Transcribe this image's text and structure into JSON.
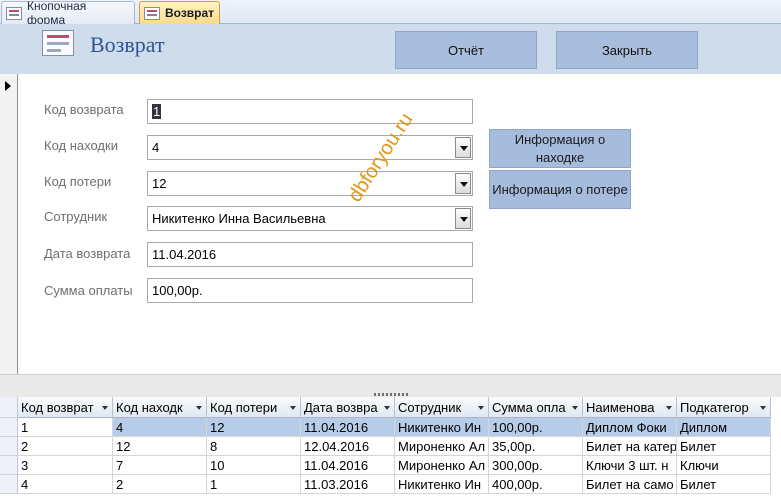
{
  "tabs": [
    {
      "label": "Кнопочная форма",
      "active": false
    },
    {
      "label": "Возврат",
      "active": true
    }
  ],
  "header": {
    "title": "Возврат",
    "report_label": "Отчёт",
    "close_label": "Закрыть"
  },
  "form": {
    "fields": [
      {
        "name": "return-id",
        "label": "Код возврата",
        "value": "1",
        "type": "text"
      },
      {
        "name": "found-id",
        "label": "Код находки",
        "value": "4",
        "type": "combo"
      },
      {
        "name": "loss-id",
        "label": "Код потери",
        "value": "12",
        "type": "combo"
      },
      {
        "name": "employee",
        "label": "Сотрудник",
        "value": "Никитенко Инна Васильевна",
        "type": "combo"
      },
      {
        "name": "return-date",
        "label": "Дата возврата",
        "value": "11.04.2016",
        "type": "text"
      },
      {
        "name": "payment-sum",
        "label": "Сумма оплаты",
        "value": "100,00р.",
        "type": "text"
      }
    ],
    "found_info_label": "Информация о находке",
    "loss_info_label": "Информация о потере",
    "watermark": "dbforyou.ru"
  },
  "datasheet": {
    "columns": [
      "Код возврат",
      "Код находк",
      "Код потери",
      "Дата возвра",
      "Сотрудник",
      "Сумма опла",
      "Наименова",
      "Подкатегор"
    ],
    "rows": [
      [
        "1",
        "4",
        "12",
        "11.04.2016",
        "Никитенко Ин",
        "100,00р.",
        "Диплом Фоки",
        "Диплом"
      ],
      [
        "2",
        "12",
        "8",
        "12.04.2016",
        "Мироненко Ал",
        "35,00р.",
        "Билет на катер",
        "Билет"
      ],
      [
        "3",
        "7",
        "10",
        "11.04.2016",
        "Мироненко Ал",
        "300,00р.",
        "Ключи 3 шт. н",
        "Ключи"
      ],
      [
        "4",
        "2",
        "1",
        "11.03.2016",
        "Никитенко Ин",
        "400,00р.",
        "Билет на само",
        "Билет"
      ]
    ],
    "selected_row": 0
  },
  "colors": {
    "header_bg": "#cfdceb",
    "title": "#2f5597",
    "button_bg": "#a9bedc",
    "active_tab": "#fbd989",
    "watermark": "#e39513",
    "selected_row": "#b7cce8"
  }
}
